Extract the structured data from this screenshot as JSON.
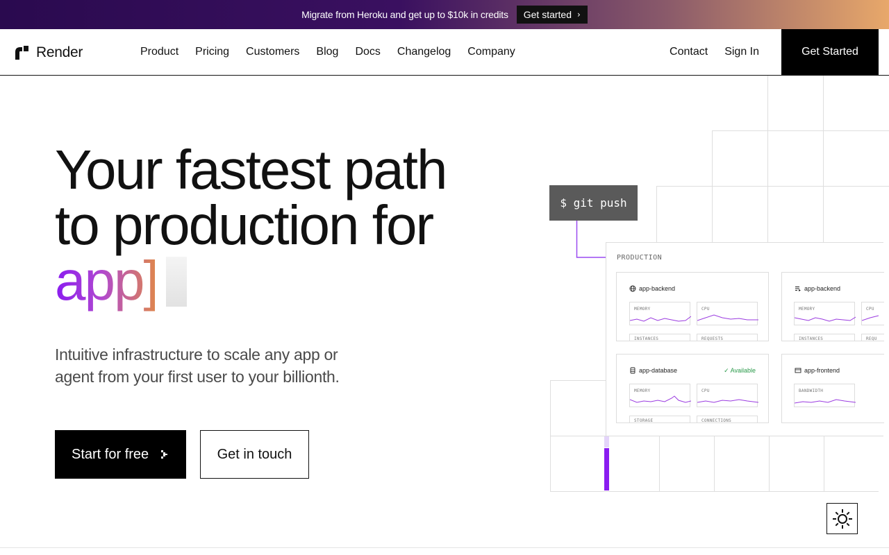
{
  "banner": {
    "text": "Migrate from Heroku and get up to $10k in credits",
    "button_label": "Get started"
  },
  "nav": {
    "brand": "Render",
    "links": [
      "Product",
      "Pricing",
      "Customers",
      "Blog",
      "Docs",
      "Changelog",
      "Company"
    ],
    "contact": "Contact",
    "sign_in": "Sign In",
    "get_started": "Get Started"
  },
  "hero": {
    "title_line1": "Your fastest path",
    "title_line2": "to production for",
    "title_word": "app]",
    "subtitle": "Intuitive infrastructure to scale any app or agent from your first user to your billionth.",
    "primary_button": "Start for free",
    "secondary_button": "Get in touch"
  },
  "illustration": {
    "command": "$ git push",
    "panel_label": "PRODUCTION",
    "services": [
      {
        "name": "app-backend",
        "icon": "globe-icon",
        "status": "",
        "metrics": [
          "MEMORY",
          "CPU"
        ],
        "bottom_metrics": [
          "INSTANCES",
          "REQUESTS"
        ]
      },
      {
        "name": "app-backend",
        "icon": "list-icon",
        "status": "",
        "metrics": [
          "MEMORY",
          "CPU"
        ],
        "bottom_metrics": [
          "INSTANCES",
          "REQU"
        ]
      },
      {
        "name": "app-database",
        "icon": "database-icon",
        "status": "✓ Available",
        "metrics": [
          "MEMORY",
          "CPU"
        ],
        "bottom_metrics": [
          "STORAGE",
          "CONNECTIONS"
        ]
      },
      {
        "name": "app-frontend",
        "icon": "window-icon",
        "status": "",
        "metrics": [
          "BANDWIDTH"
        ],
        "bottom_metrics": []
      }
    ]
  },
  "colors": {
    "accent": "#8a1cf0",
    "status_green": "#2a9a4a",
    "black": "#000000"
  }
}
